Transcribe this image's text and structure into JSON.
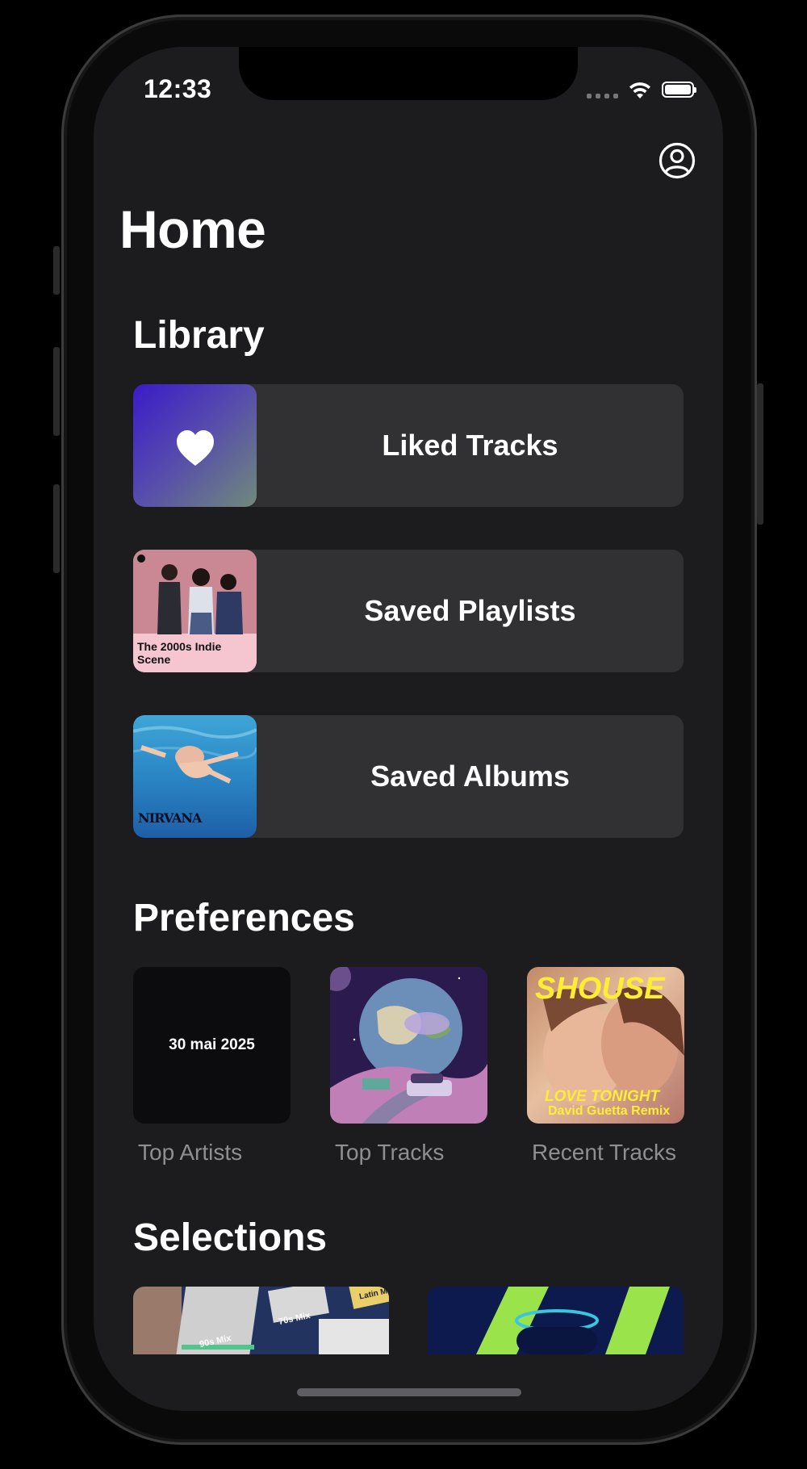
{
  "status_bar": {
    "time": "12:33"
  },
  "page_title": "Home",
  "library": {
    "title": "Library",
    "items": [
      {
        "label": "Liked Tracks",
        "icon": "heart-icon"
      },
      {
        "label": "Saved Playlists",
        "cover_text": "The 2000s Indie Scene"
      },
      {
        "label": "Saved Albums",
        "cover_text": "NIRVANA"
      }
    ]
  },
  "preferences": {
    "title": "Preferences",
    "items": [
      {
        "label": "Top Artists",
        "cover_text": "30 mai 2025"
      },
      {
        "label": "Top Tracks"
      },
      {
        "label": "Recent Tracks",
        "cover_title": "SHOUSE",
        "cover_subtitle": "LOVE TONIGHT",
        "cover_artist": "David Guetta Remix"
      }
    ]
  },
  "selections": {
    "title": "Selections",
    "items": [
      {
        "cover_texts": [
          "90s Mix",
          "70s Mix",
          "Latin M"
        ]
      },
      {}
    ]
  },
  "colors": {
    "background": "#1c1c1e",
    "row": "#313134",
    "secondary_text": "#8e8e93"
  }
}
